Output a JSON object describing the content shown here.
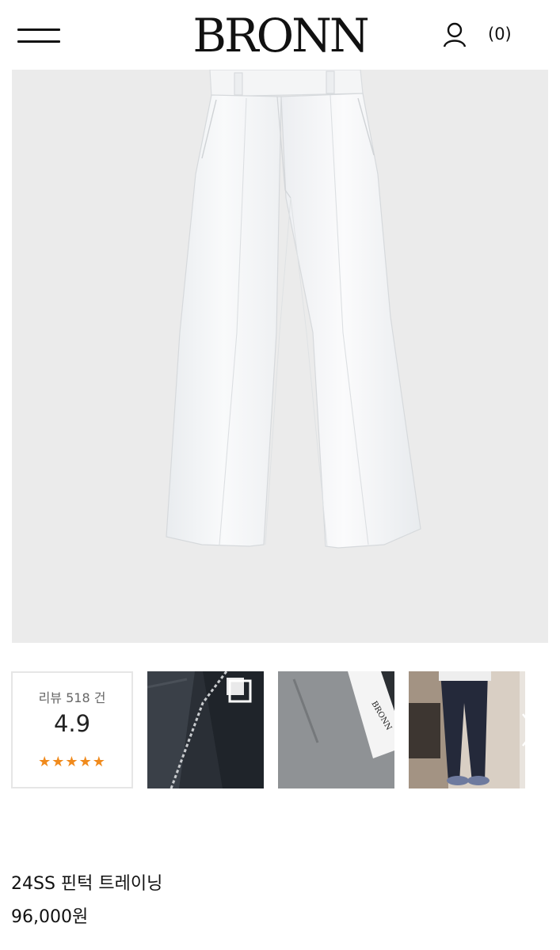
{
  "header": {
    "logo": "BRONN",
    "cart_count": "(0)"
  },
  "hero": {
    "image_desc": "white wide-leg pin-tuck trousers"
  },
  "reviews": {
    "label": "리뷰 518 건",
    "score": "4.9",
    "stars": "★★★★★",
    "star_color": "#f08a1c"
  },
  "product": {
    "name": "24SS 핀턱 트레이닝",
    "price": "96,000원"
  },
  "colors": {
    "hero_bg": "#ebebeb",
    "star": "#f08a1c"
  }
}
